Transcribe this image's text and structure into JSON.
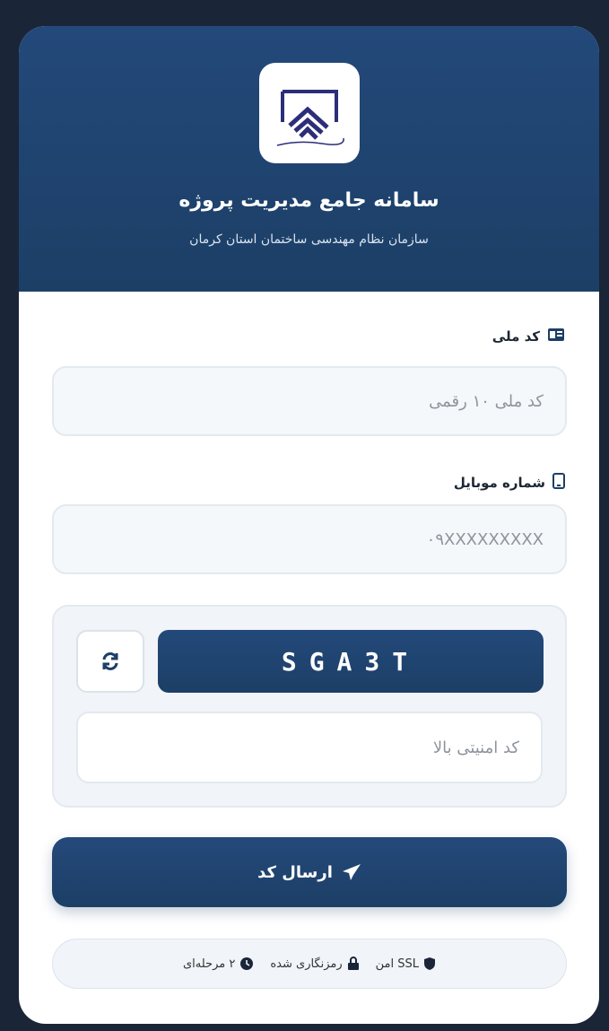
{
  "header": {
    "title": "سامانه جامع مدیریت پروژه",
    "subtitle": "سازمان نظام مهندسی ساختمان استان کرمان",
    "logo_text": "سازمان نظام مهندسی ساختمان"
  },
  "form": {
    "national_code": {
      "label": "کد ملی",
      "placeholder": "کد ملی ۱۰ رقمی",
      "icon": "id-card-icon"
    },
    "mobile": {
      "label": "شماره موبایل",
      "placeholder": "۰۹XXXXXXXXX",
      "icon": "mobile-icon"
    },
    "captcha": {
      "code": "SGA3T",
      "placeholder": "کد امنیتی بالا",
      "refresh_icon": "refresh-icon"
    },
    "submit_label": "ارسال کد"
  },
  "footer": {
    "items": [
      {
        "label": "SSL امن",
        "icon": "shield-icon"
      },
      {
        "label": "رمزنگاری شده",
        "icon": "lock-icon"
      },
      {
        "label": "۲ مرحله‌ای",
        "icon": "clock-icon"
      }
    ]
  },
  "colors": {
    "primary": "#1c3f66",
    "background": "#1a2538"
  }
}
